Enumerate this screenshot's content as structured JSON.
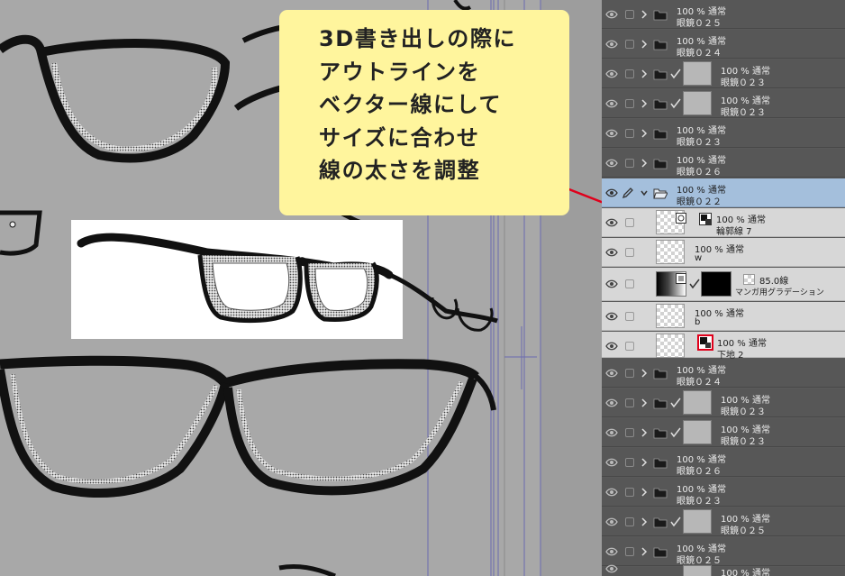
{
  "callout": {
    "lines": [
      "3D書き出しの際に",
      "アウトラインを",
      "ベクター線にして",
      "サイズに合わせ",
      "線の太さを調整"
    ]
  },
  "colors": {
    "canvas_bg": "#a8a8a8",
    "panel_bg": "#575757",
    "selected_row": "#a4bfdc",
    "expanded_row": "#d7d7d7",
    "callout_bg": "#fff59d",
    "pointer_line": "#e0001b",
    "guide_line": "#5a5aa8"
  },
  "layers": [
    {
      "opacity": "100 % 通常",
      "name": "眼鏡０２５"
    },
    {
      "opacity": "100 % 通常",
      "name": "眼鏡０２４"
    },
    {
      "opacity": "100 % 通常",
      "name": "眼鏡０２３"
    },
    {
      "opacity": "100 % 通常",
      "name": "眼鏡０２３"
    },
    {
      "opacity": "100 % 通常",
      "name": "眼鏡０２３"
    },
    {
      "opacity": "100 % 通常",
      "name": "眼鏡０２６"
    },
    {
      "opacity": "100 % 通常",
      "name": "眼鏡０２２"
    },
    {
      "opacity": "100 % 通常",
      "name": "輪郭線 7"
    },
    {
      "opacity": "100 % 通常",
      "name": "w"
    },
    {
      "opacity": "85.0線",
      "name": "マンガ用グラデーション"
    },
    {
      "opacity": "100 % 通常",
      "name": "b"
    },
    {
      "opacity": "100 % 通常",
      "name": "下地 2"
    },
    {
      "opacity": "100 % 通常",
      "name": "眼鏡０２４"
    },
    {
      "opacity": "100 % 通常",
      "name": "眼鏡０２３"
    },
    {
      "opacity": "100 % 通常",
      "name": "眼鏡０２３"
    },
    {
      "opacity": "100 % 通常",
      "name": "眼鏡０２６"
    },
    {
      "opacity": "100 % 通常",
      "name": "眼鏡０２３"
    },
    {
      "opacity": "100 % 通常",
      "name": "眼鏡０２５"
    },
    {
      "opacity": "100 % 通常",
      "name": "眼鏡０２５"
    },
    {
      "opacity": "100 % 通常",
      "name": ""
    }
  ],
  "icons": [
    "eye-icon",
    "lock-checkbox-icon",
    "chevron-right-icon",
    "chevron-down-icon",
    "folder-icon",
    "folder-open-icon",
    "checkmark-icon",
    "pen-icon",
    "vector-layer-icon",
    "layer-mask-icon",
    "tone-pattern-icon"
  ]
}
